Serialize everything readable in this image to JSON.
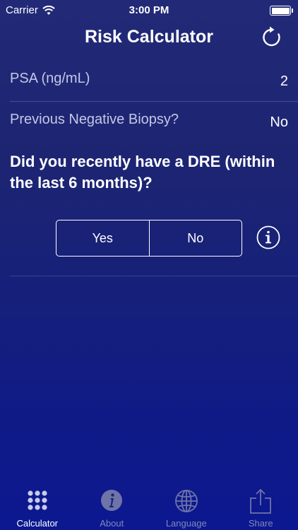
{
  "status_bar": {
    "carrier": "Carrier",
    "time": "3:00 PM",
    "wifi_icon": "wifi-icon",
    "battery_icon": "battery-icon"
  },
  "nav": {
    "title": "Risk Calculator",
    "refresh_icon": "refresh-icon"
  },
  "fields": [
    {
      "label": "PSA (ng/mL)",
      "value": "2"
    },
    {
      "label": "Previous Negative Biopsy?",
      "value": "No"
    }
  ],
  "question": {
    "text": "Did you recently have a DRE (within the last 6 months)?",
    "options": [
      "Yes",
      "No"
    ],
    "info_icon": "info-icon"
  },
  "tabbar": {
    "tabs": [
      {
        "label": "Calculator",
        "icon": "grid-icon",
        "active": true
      },
      {
        "label": "About",
        "icon": "info-circle-icon",
        "active": false
      },
      {
        "label": "Language",
        "icon": "globe-icon",
        "active": false
      },
      {
        "label": "Share",
        "icon": "share-icon",
        "active": false
      }
    ]
  },
  "colors": {
    "background_top": "#222a78",
    "background_bottom": "#0c1890",
    "label_text": "#c4c7e6",
    "inactive_tab": "#8288b8"
  }
}
